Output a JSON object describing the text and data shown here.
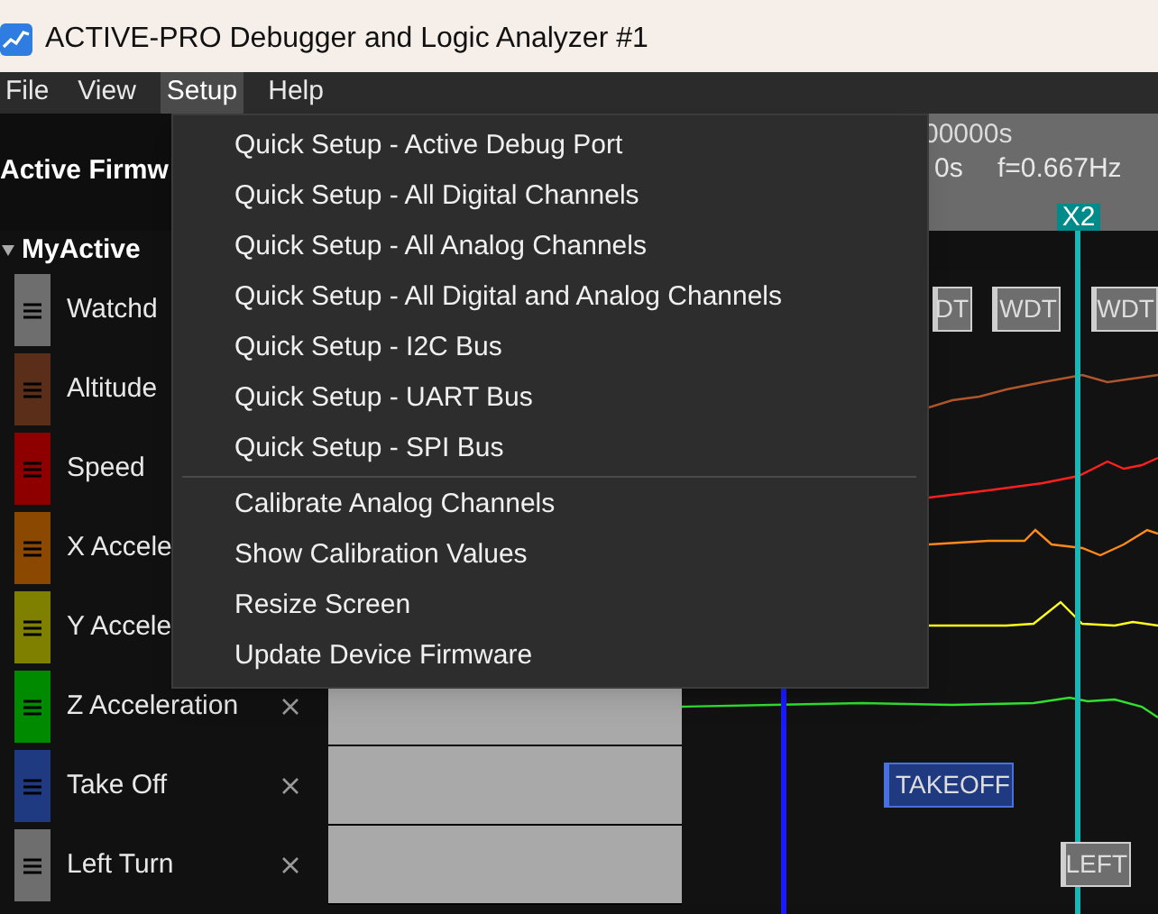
{
  "window": {
    "title": "ACTIVE-PRO Debugger and Logic Analyzer #1"
  },
  "menu_bar": [
    {
      "label": "File",
      "selected": false
    },
    {
      "label": "View",
      "selected": false
    },
    {
      "label": "Setup",
      "selected": true
    },
    {
      "label": "Help",
      "selected": false
    }
  ],
  "setup_menu": {
    "items": [
      {
        "label": "Quick Setup - Active Debug Port",
        "divider_before": false
      },
      {
        "label": "Quick Setup - All Digital Channels",
        "divider_before": false
      },
      {
        "label": "Quick Setup - All Analog Channels",
        "divider_before": false
      },
      {
        "label": "Quick Setup - All Digital and Analog Channels",
        "divider_before": false
      },
      {
        "label": "Quick Setup - I2C Bus",
        "divider_before": false
      },
      {
        "label": "Quick Setup - UART Bus",
        "divider_before": false
      },
      {
        "label": "Quick Setup - SPI Bus",
        "divider_before": false
      },
      {
        "label": "Calibrate Analog Channels",
        "divider_before": true
      },
      {
        "label": "Show Calibration Values",
        "divider_before": false
      },
      {
        "label": "Resize Screen",
        "divider_before": false
      },
      {
        "label": "Update Device Firmware",
        "divider_before": false
      }
    ]
  },
  "toolbar": {
    "firmware_label": "Active Firmw",
    "time_readout": "00000s",
    "period_readout": "0s",
    "frequency_readout": "f=0.667Hz"
  },
  "cursors": [
    {
      "kind": "plain",
      "color": "#1a1aff"
    },
    {
      "kind": "labeled",
      "label": "X2",
      "color": "#1ab5b5"
    }
  ],
  "channel_group": {
    "name": "MyActive",
    "expanded": true
  },
  "channels": [
    {
      "name": "Watchd",
      "color": "#6e6e6e",
      "kind": "event",
      "tags": [
        "DT",
        "WDT",
        "WDT"
      ]
    },
    {
      "name": "Altitude",
      "color": "#5a2e18",
      "kind": "analog"
    },
    {
      "name": "Speed",
      "color": "#8e0000",
      "kind": "analog"
    },
    {
      "name": "X Accele",
      "color": "#8a4800",
      "kind": "analog"
    },
    {
      "name": "Y Accele",
      "color": "#7f7f00",
      "kind": "analog"
    },
    {
      "name": "Z Acceleration",
      "color": "#008a00",
      "kind": "analog"
    },
    {
      "name": "Take Off",
      "color": "#1f3a80",
      "kind": "event",
      "tags": [
        "TAKEOFF"
      ]
    },
    {
      "name": "Left Turn",
      "color": "#6e6e6e",
      "kind": "event",
      "tags": [
        "LEFT"
      ]
    }
  ]
}
